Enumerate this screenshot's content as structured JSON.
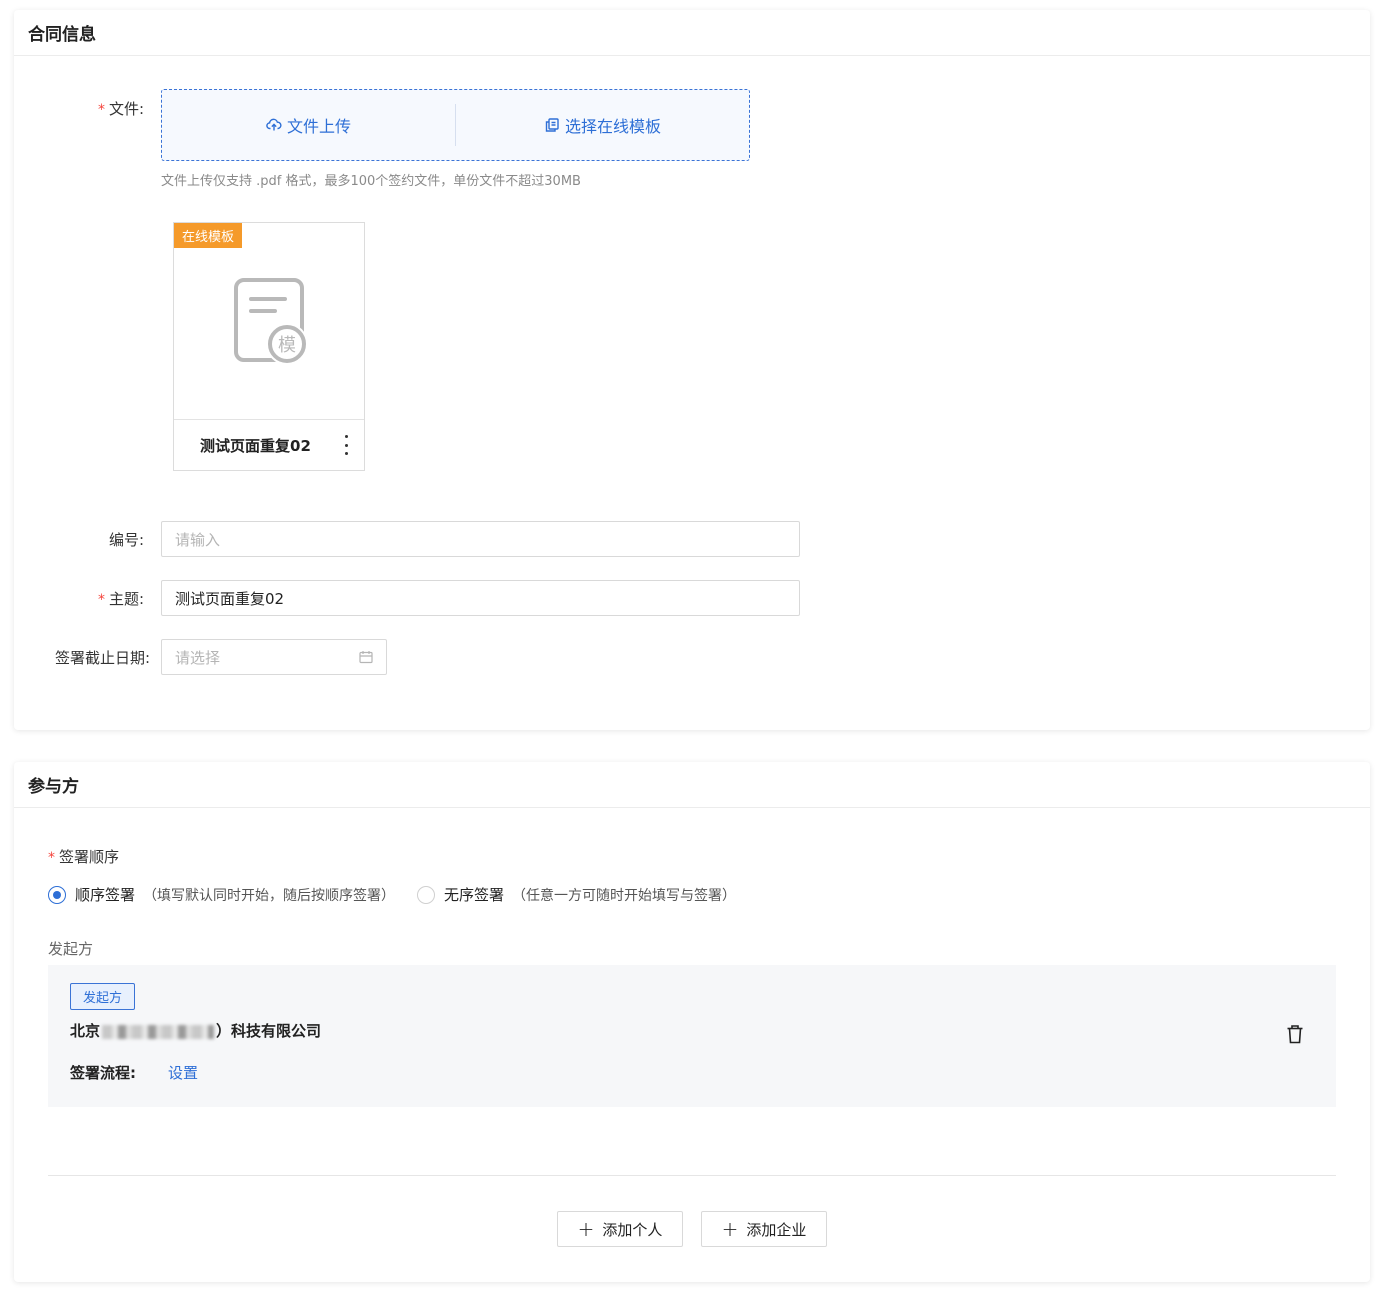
{
  "contract_info": {
    "title": "合同信息",
    "file_label": "文件:",
    "upload_label": "文件上传",
    "template_label": "选择在线模板",
    "hint": "文件上传仅支持 .pdf 格式，最多100个签约文件，单份文件不超过30MB",
    "file_card": {
      "tag": "在线模板",
      "thumb_char": "模",
      "name": "测试页面重复02"
    },
    "number_label": "编号:",
    "number_placeholder": "请输入",
    "subject_label": "主题:",
    "subject_value": "测试页面重复02",
    "deadline_label": "签署截止日期:",
    "deadline_placeholder": "请选择"
  },
  "participants": {
    "title": "参与方",
    "order_label": "签署顺序",
    "options": [
      {
        "label": "顺序签署",
        "desc": "（填写默认同时开始，随后按顺序签署）",
        "checked": true
      },
      {
        "label": "无序签署",
        "desc": "（任意一方可随时开始填写与签署）",
        "checked": false
      }
    ],
    "initiator_section": "发起方",
    "initiator": {
      "badge": "发起方",
      "company_prefix": "北京",
      "company_suffix": "）科技有限公司",
      "flow_label": "签署流程:",
      "flow_link": "设置"
    },
    "add_person": "添加个人",
    "add_company": "添加企业"
  },
  "colors": {
    "accent": "#2e6fd6",
    "required": "#f5453d",
    "tag": "#f59a2a"
  }
}
